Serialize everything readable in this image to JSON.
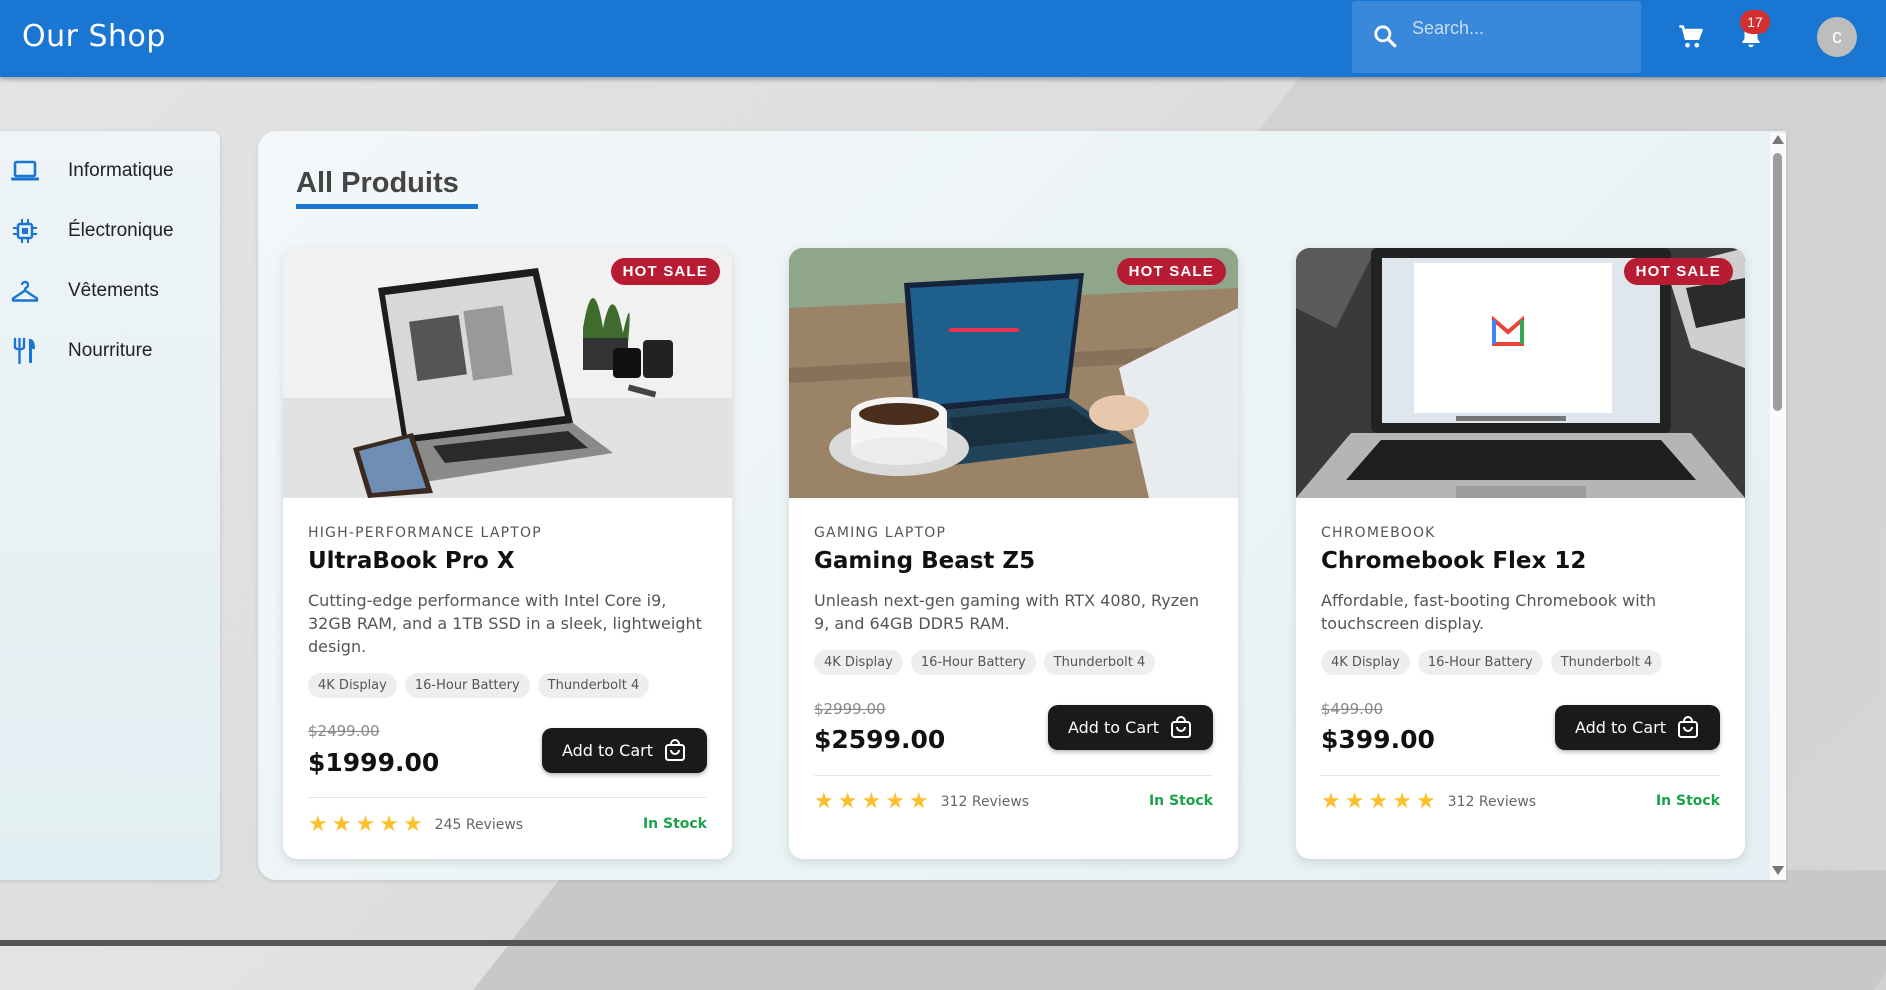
{
  "header": {
    "brand": "Our Shop",
    "search_placeholder": "Search...",
    "notification_count": "17",
    "avatar_initial": "c"
  },
  "sidebar": {
    "items": [
      {
        "label": "Informatique",
        "icon": "laptop-icon"
      },
      {
        "label": "Électronique",
        "icon": "chip-icon"
      },
      {
        "label": "Vêtements",
        "icon": "hanger-icon"
      },
      {
        "label": "Nourriture",
        "icon": "utensils-icon"
      }
    ]
  },
  "main": {
    "title": "All Produits",
    "products": [
      {
        "badge": "HOT SALE",
        "category": "HIGH-PERFORMANCE LAPTOP",
        "name": "UltraBook Pro X",
        "description": "Cutting-edge performance with Intel Core i9, 32GB RAM, and a 1TB SSD in a sleek, lightweight design.",
        "tags": [
          "4K Display",
          "16-Hour Battery",
          "Thunderbolt 4"
        ],
        "old_price": "$2499.00",
        "price": "$1999.00",
        "button": "Add to Cart",
        "rating": 5,
        "reviews": "245 Reviews",
        "stock": "In Stock"
      },
      {
        "badge": "HOT SALE",
        "category": "GAMING LAPTOP",
        "name": "Gaming Beast Z5",
        "description": "Unleash next-gen gaming with RTX 4080, Ryzen 9, and 64GB DDR5 RAM.",
        "tags": [
          "4K Display",
          "16-Hour Battery",
          "Thunderbolt 4"
        ],
        "old_price": "$2999.00",
        "price": "$2599.00",
        "button": "Add to Cart",
        "rating": 5,
        "reviews": "312 Reviews",
        "stock": "In Stock"
      },
      {
        "badge": "HOT SALE",
        "category": "CHROMEBOOK",
        "name": "Chromebook Flex 12",
        "description": "Affordable, fast-booting Chromebook with touchscreen display.",
        "tags": [
          "4K Display",
          "16-Hour Battery",
          "Thunderbolt 4"
        ],
        "old_price": "$499.00",
        "price": "$399.00",
        "button": "Add to Cart",
        "rating": 5,
        "reviews": "312 Reviews",
        "stock": "In Stock"
      }
    ]
  },
  "colors": {
    "appbar": "#1976d2",
    "badge": "#b71c33",
    "stock": "#1aa34a",
    "star": "#fbc02d"
  }
}
